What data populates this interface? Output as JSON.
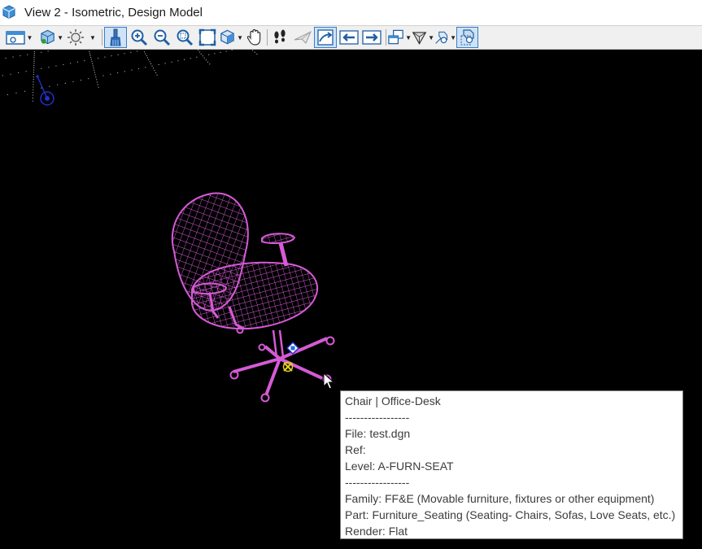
{
  "window": {
    "title": "View 2 - Isometric, Design Model",
    "icon": "view-window-icon"
  },
  "toolbar": {
    "buttons": [
      {
        "icon": "view-attributes-icon",
        "dropdown": true,
        "active": false
      },
      {
        "icon": "display-style-icon",
        "dropdown": true,
        "active": false
      },
      {
        "icon": "lighting-icon",
        "dropdown": true,
        "active": false
      },
      {
        "icon": "update-view-brush-icon",
        "dropdown": false,
        "active": true
      },
      {
        "icon": "zoom-in-icon",
        "dropdown": false,
        "active": false
      },
      {
        "icon": "zoom-out-icon",
        "dropdown": false,
        "active": false
      },
      {
        "icon": "window-area-icon",
        "dropdown": false,
        "active": false
      },
      {
        "icon": "fit-view-icon",
        "dropdown": false,
        "active": false
      },
      {
        "icon": "rotate-view-icon",
        "dropdown": true,
        "active": false
      },
      {
        "icon": "pan-view-hand-icon",
        "dropdown": false,
        "active": false
      },
      {
        "icon": "walk-footprints-icon",
        "dropdown": false,
        "active": false
      },
      {
        "icon": "fly-icon",
        "dropdown": false,
        "active": false
      },
      {
        "icon": "view-previous-next-icon",
        "dropdown": false,
        "active": true
      },
      {
        "icon": "previous-view-arrow-icon",
        "dropdown": false,
        "active": false
      },
      {
        "icon": "next-view-arrow-icon",
        "dropdown": false,
        "active": false
      },
      {
        "icon": "copy-view-icon",
        "dropdown": true,
        "active": false
      },
      {
        "icon": "camera-frustum-icon",
        "dropdown": true,
        "active": false
      },
      {
        "icon": "clip-volume-icon",
        "dropdown": true,
        "active": false
      },
      {
        "icon": "clip-mask-icon",
        "dropdown": false,
        "active": true
      }
    ]
  },
  "viewport": {
    "background": "#000000",
    "grid_color": "#d8d8d8",
    "element_color": "#d65ad6",
    "axis_triad_color": "#2030c8",
    "snap_marker_color": "#e0d020"
  },
  "tooltip": {
    "lines": [
      "Chair | Office-Desk",
      "-----------------",
      "File: test.dgn",
      "Ref:",
      "Level: A-FURN-SEAT",
      "-----------------",
      "Family: FF&E (Movable furniture, fixtures or other equipment)",
      "Part: Furniture_Seating (Seating- Chairs, Sofas, Love Seats, etc.)",
      "Render: Flat"
    ]
  }
}
